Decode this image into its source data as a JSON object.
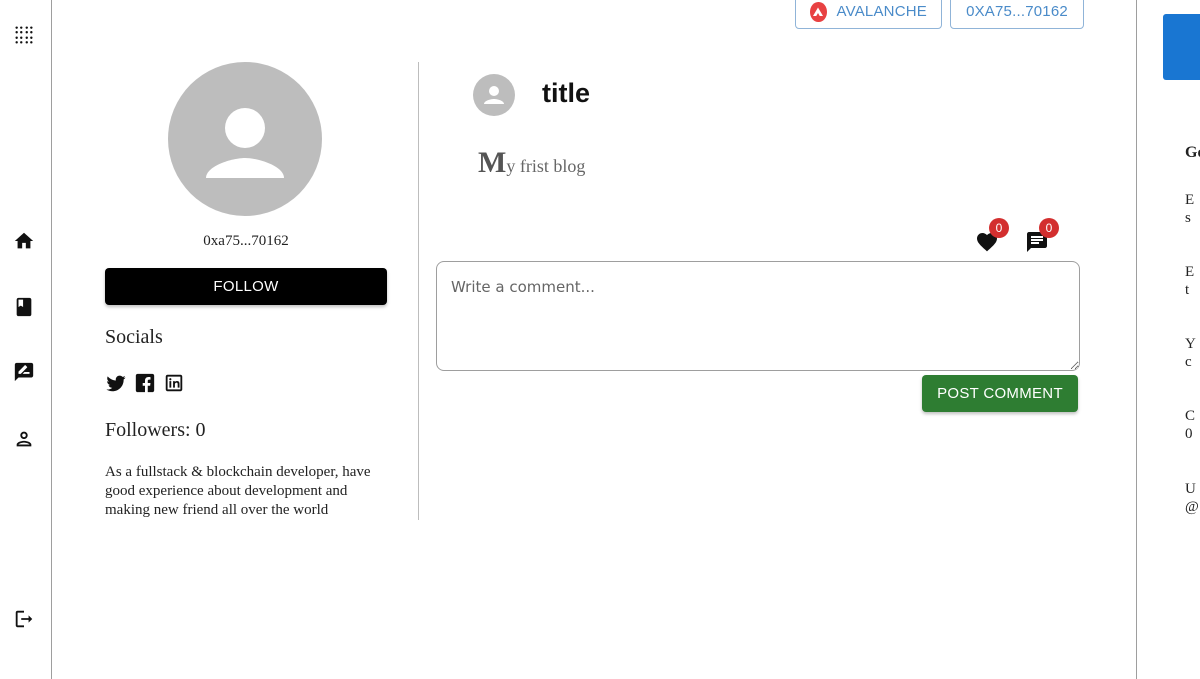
{
  "header": {
    "network_label": "AVALANCHE",
    "wallet_label": "0XA75...70162"
  },
  "sidebar": {
    "items": [
      {
        "icon": "apps-icon"
      },
      {
        "icon": "home-icon"
      },
      {
        "icon": "book-icon"
      },
      {
        "icon": "edit-note-icon"
      },
      {
        "icon": "person-icon"
      },
      {
        "icon": "logout-icon"
      }
    ]
  },
  "profile": {
    "wallet_address": "0xa75...70162",
    "follow_label": "FOLLOW",
    "socials_title": "Socials",
    "social_icons": [
      "twitter-icon",
      "facebook-icon",
      "linkedin-icon"
    ],
    "followers_text": "Followers: 0",
    "bio": "As a fullstack & blockchain developer, have good experience about development and making new friend all over the world"
  },
  "post": {
    "title": "title",
    "body_first_letter": "M",
    "body_rest": "y frist blog",
    "like_count": "0",
    "comment_count": "0"
  },
  "comment": {
    "placeholder": "Write a comment...",
    "submit_label": "POST COMMENT"
  },
  "right_panel": {
    "fragments": [
      "Go",
      "E",
      "s",
      "E",
      "t",
      "Y",
      "c",
      "C",
      "0",
      "U",
      "@"
    ]
  },
  "colors": {
    "follow_bg": "#000000",
    "post_comment_bg": "#2e7d32",
    "badge": "#d32f2f",
    "avalanche": "#e84142",
    "chip_text": "#4a8bc9",
    "accent_blue": "#1976d2"
  }
}
